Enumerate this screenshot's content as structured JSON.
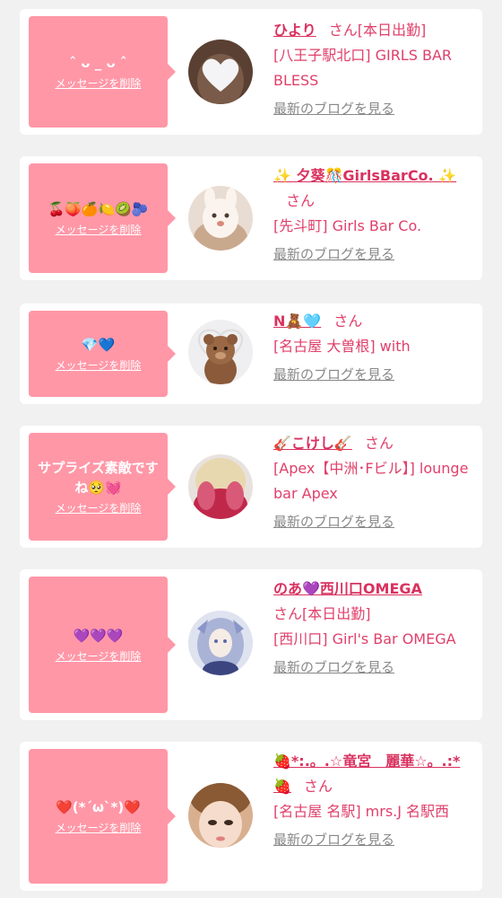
{
  "cards": [
    {
      "message": "ˆ ᴗ _ ᴗ ˆ",
      "delete_label": "メッセージを削除",
      "name": "ひより",
      "honorific": "さん",
      "tag": "[本日出勤]",
      "shop": "[八王子駅北口] GIRLS BAR BLESS",
      "blog_label": "最新のブログを見る"
    },
    {
      "message": "🍒🍑🍊🍋🥝🫐",
      "delete_label": "メッセージを削除",
      "name": "✨ 夕葵🎊GirlsBarCo. ✨",
      "honorific": "さん",
      "tag": "",
      "shop": "[先斗町] Girls Bar Co.",
      "blog_label": "最新のブログを見る"
    },
    {
      "message": "💎💙",
      "delete_label": "メッセージを削除",
      "name": "N🧸🩵",
      "honorific": "さん",
      "tag": "",
      "shop": "[名古屋 大曽根] with",
      "blog_label": "最新のブログを見る"
    },
    {
      "message": "サプライズ素敵ですね🥺💓",
      "delete_label": "メッセージを削除",
      "name": "🎸こけし🎸",
      "honorific": "さん",
      "tag": "",
      "shop": "[Apex【中洲･Fビル】] lounge bar Apex",
      "blog_label": "最新のブログを見る"
    },
    {
      "message": "💜💜💜",
      "delete_label": "メッセージを削除",
      "name": "のあ💜西川口OMEGA",
      "honorific": "さん",
      "tag": "[本日出勤]",
      "shop": "[西川口] Girl's Bar OMEGA",
      "blog_label": "最新のブログを見る"
    },
    {
      "message": "❤️(*´ω`*)❤️",
      "delete_label": "メッセージを削除",
      "name": "🍓*:.。.☆竜宮　麗華☆。.:*🍓",
      "honorific": "さん",
      "tag": "",
      "shop": "[名古屋 名駅] mrs.J 名駅西",
      "blog_label": "最新のブログを見る"
    }
  ],
  "colors": {
    "bubble": "#ff97a7",
    "name": "#d9325f",
    "text": "#e0406a",
    "blog": "#888888",
    "background": "#f1f1f1"
  },
  "icons": [
    "heart-mask-avatar",
    "bunny-avatar",
    "teddy-bear-avatar",
    "pink-hair-avatar",
    "anime-avatar",
    "face-avatar"
  ]
}
